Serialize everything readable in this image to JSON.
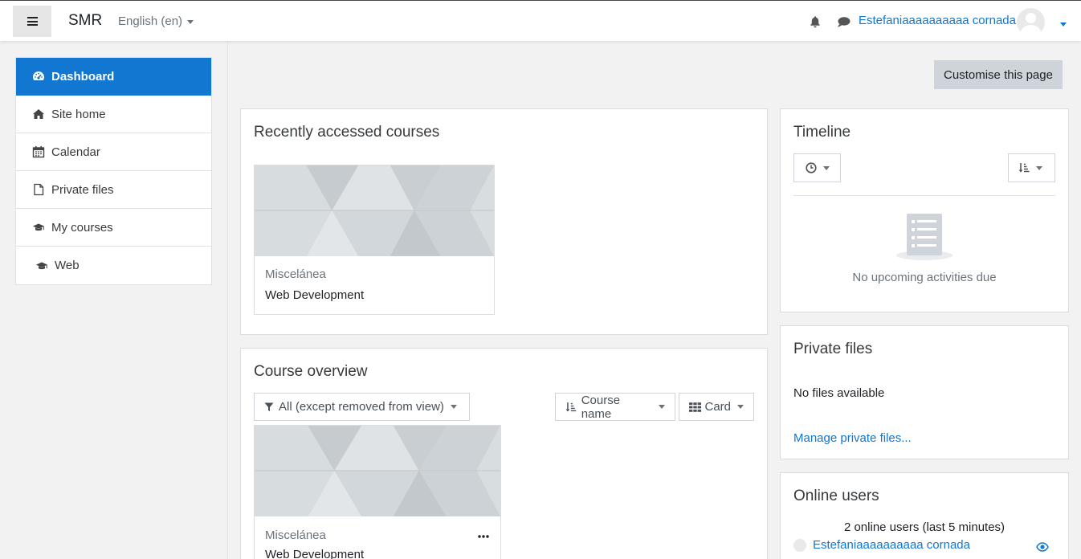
{
  "navbar": {
    "brand": "SMR",
    "language": "English (en)",
    "user_name": "Estefaniaaaaaaaaaa cornada"
  },
  "sidebar": {
    "items": [
      {
        "label": "Dashboard",
        "icon": "dashboard-icon",
        "active": true
      },
      {
        "label": "Site home",
        "icon": "home-icon"
      },
      {
        "label": "Calendar",
        "icon": "calendar-icon"
      },
      {
        "label": "Private files",
        "icon": "file-icon"
      },
      {
        "label": "My courses",
        "icon": "graduation-cap-icon"
      },
      {
        "label": "Web",
        "icon": "graduation-cap-icon"
      }
    ]
  },
  "main": {
    "customise_label": "Customise this page",
    "recent": {
      "title": "Recently accessed courses",
      "course": {
        "category": "Miscelánea",
        "name": "Web Development"
      }
    },
    "overview": {
      "title": "Course overview",
      "filter_label": "All (except removed from view)",
      "sort_label": "Course name",
      "view_label": "Card",
      "course": {
        "category": "Miscelánea",
        "name": "Web Development"
      }
    }
  },
  "right": {
    "timeline": {
      "title": "Timeline",
      "empty_text": "No upcoming activities due"
    },
    "private_files": {
      "title": "Private files",
      "empty_text": "No files available",
      "manage_link": "Manage private files..."
    },
    "online_users": {
      "title": "Online users",
      "summary": "2 online users (last 5 minutes)",
      "user": "Estefaniaaaaaaaaaa cornada"
    }
  },
  "colors": {
    "accent": "#1177d1",
    "background": "#f2f2f2",
    "button_secondary": "#ced4da"
  }
}
